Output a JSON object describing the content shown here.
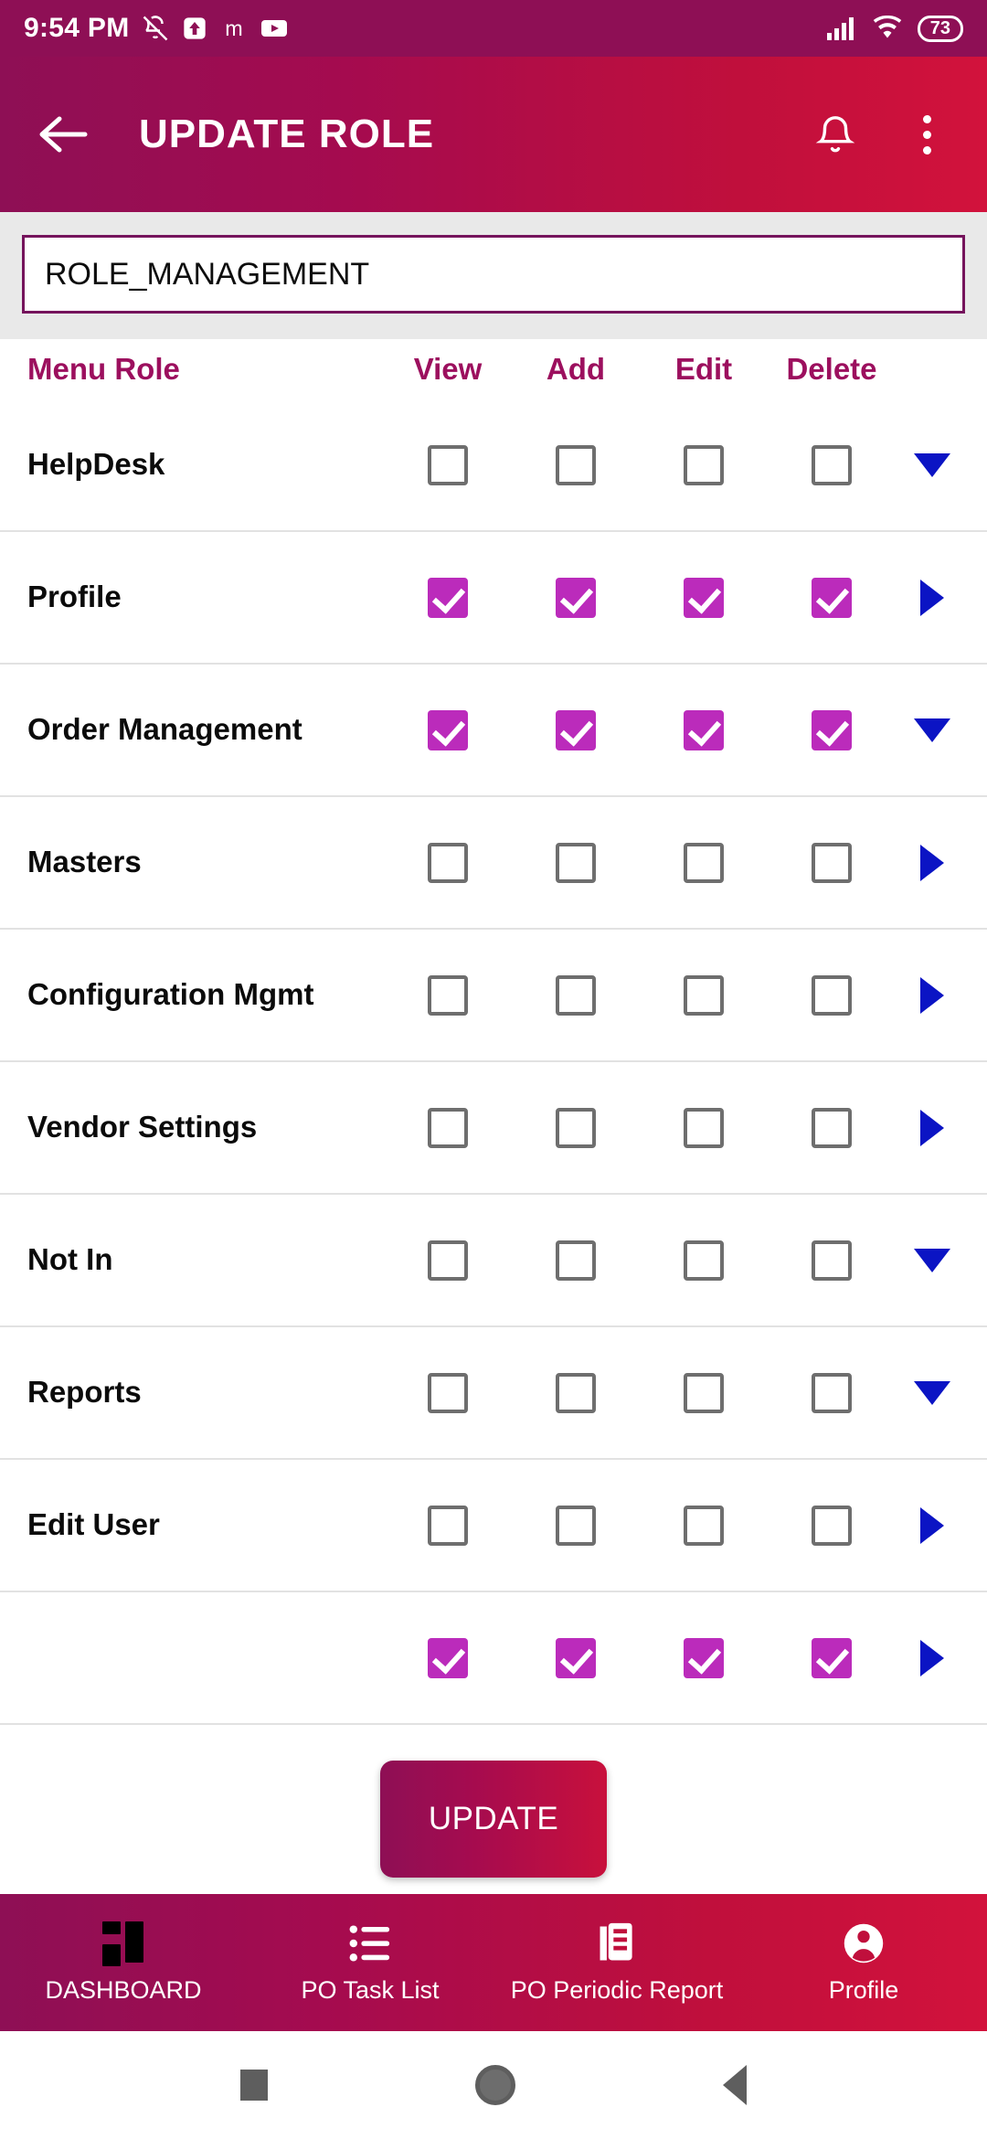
{
  "status_bar": {
    "time": "9:54 PM",
    "left_icons": [
      "bell-off-icon",
      "upload-arrow-icon",
      "m-app-icon",
      "youtube-icon"
    ],
    "right_icons": [
      "signal-icon",
      "wifi-icon"
    ],
    "battery_level": "73"
  },
  "app_bar": {
    "back_icon": "back-arrow-icon",
    "title": "UPDATE ROLE",
    "notification_icon": "bell-icon",
    "overflow_icon": "more-vertical-icon",
    "gradient_start": "#8e0f55",
    "gradient_end": "#d2123c"
  },
  "role_field": {
    "value": "ROLE_MANAGEMENT",
    "placeholder": "Role Name",
    "border_color": "#75145c"
  },
  "table": {
    "headers": {
      "menu_role": "Menu Role",
      "view": "View",
      "add": "Add",
      "edit": "Edit",
      "delete": "Delete"
    },
    "header_color": "#9c0f5e",
    "checked_color": "#bb2bbb",
    "unchecked_border_color": "#6e6e6e",
    "arrow_color": "#0b14c4",
    "rows": [
      {
        "label": "HelpDesk",
        "view": false,
        "add": false,
        "edit": false,
        "delete": false,
        "expand": "down"
      },
      {
        "label": "Profile",
        "view": true,
        "add": true,
        "edit": true,
        "delete": true,
        "expand": "right"
      },
      {
        "label": "Order Management",
        "view": true,
        "add": true,
        "edit": true,
        "delete": true,
        "expand": "down"
      },
      {
        "label": "Masters",
        "view": false,
        "add": false,
        "edit": false,
        "delete": false,
        "expand": "right"
      },
      {
        "label": "Configuration Mgmt",
        "view": false,
        "add": false,
        "edit": false,
        "delete": false,
        "expand": "right"
      },
      {
        "label": "Vendor Settings",
        "view": false,
        "add": false,
        "edit": false,
        "delete": false,
        "expand": "right"
      },
      {
        "label": "Not In",
        "view": false,
        "add": false,
        "edit": false,
        "delete": false,
        "expand": "down"
      },
      {
        "label": "Reports",
        "view": false,
        "add": false,
        "edit": false,
        "delete": false,
        "expand": "down"
      },
      {
        "label": "Edit User",
        "view": false,
        "add": false,
        "edit": false,
        "delete": false,
        "expand": "right"
      },
      {
        "label": "",
        "view": true,
        "add": true,
        "edit": true,
        "delete": true,
        "expand": "right"
      }
    ]
  },
  "update_button": {
    "label": "UPDATE",
    "gradient_start": "#8e0f55",
    "gradient_end": "#c8103c"
  },
  "bottom_nav": {
    "items": [
      {
        "label": "DASHBOARD",
        "icon": "dashboard-grid-icon"
      },
      {
        "label": "PO Task List",
        "icon": "list-icon"
      },
      {
        "label": "PO Periodic Report",
        "icon": "document-report-icon"
      },
      {
        "label": "Profile",
        "icon": "person-icon"
      }
    ]
  },
  "system_nav": {
    "recents": "recents-square-icon",
    "home": "home-circle-icon",
    "back": "back-triangle-icon"
  }
}
